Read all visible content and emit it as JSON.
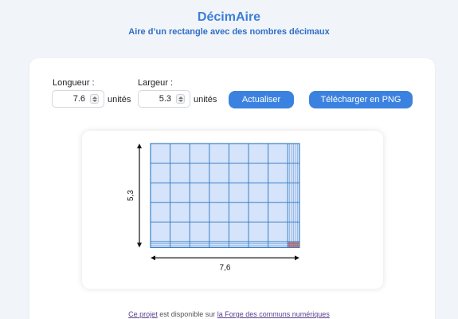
{
  "header": {
    "title": "DécimAire",
    "subtitle": "Aire d’un rectangle avec des nombres décimaux"
  },
  "form": {
    "length_label": "Longueur :",
    "length_value": "7.6",
    "width_label": "Largeur :",
    "width_value": "5.3",
    "unit_label": "unités",
    "update_button": "Actualiser",
    "download_button": "Télécharger en PNG"
  },
  "figure": {
    "length": 7.6,
    "width": 5.3,
    "length_label": "7,6",
    "width_label": "5,3",
    "colors": {
      "cell_fill": "#d6e4fb",
      "grid_line": "#3a7fc4",
      "corner_fill": "#e07a70",
      "axis": "#111111"
    }
  },
  "footer": {
    "link1": "Ce projet",
    "middle": " est disponible sur ",
    "link2": "la Forge des communs numériques"
  },
  "colors": {
    "background": "#f1f4f9",
    "title": "#3d7fd6",
    "button": "#3b82e0"
  }
}
